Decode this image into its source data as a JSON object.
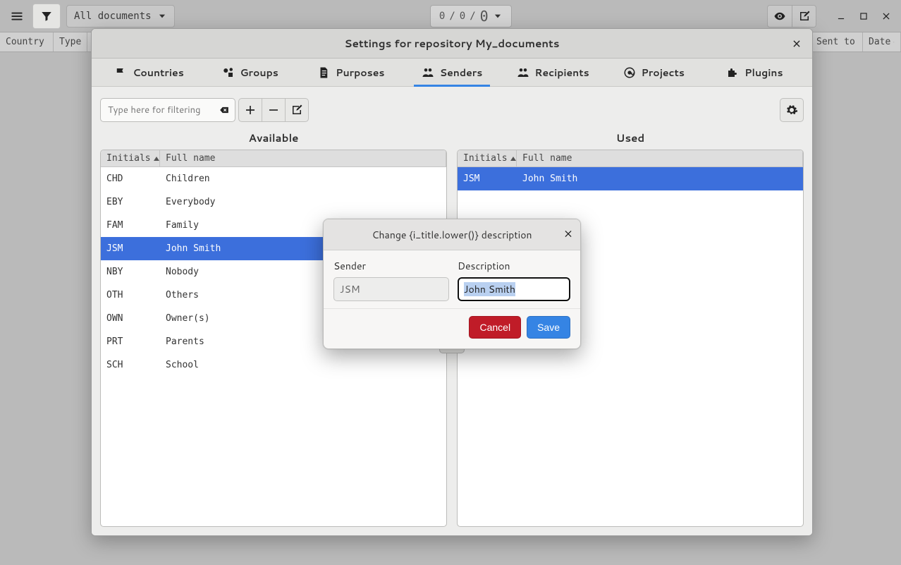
{
  "topbar": {
    "doc_selector": "All documents",
    "counter": {
      "a": "0",
      "b": "0",
      "c": "0"
    }
  },
  "columns": {
    "country": "Country",
    "type": "Type",
    "sent_to": "Sent to",
    "date": "Date"
  },
  "settings": {
    "title": "Settings for repository My_documents",
    "tabs": {
      "countries": "Countries",
      "groups": "Groups",
      "purposes": "Purposes",
      "senders": "Senders",
      "recipients": "Recipients",
      "projects": "Projects",
      "plugins": "Plugins"
    },
    "filter_placeholder": "Type here for filtering",
    "available_label": "Available",
    "used_label": "Used",
    "col_initials": "Initials",
    "col_full": "Full name",
    "available": [
      {
        "initials": "CHD",
        "full": "Children",
        "selected": false
      },
      {
        "initials": "EBY",
        "full": "Everybody",
        "selected": false
      },
      {
        "initials": "FAM",
        "full": "Family",
        "selected": false
      },
      {
        "initials": "JSM",
        "full": "John Smith",
        "selected": true
      },
      {
        "initials": "NBY",
        "full": "Nobody",
        "selected": false
      },
      {
        "initials": "OTH",
        "full": "Others",
        "selected": false
      },
      {
        "initials": "OWN",
        "full": "Owner(s)",
        "selected": false
      },
      {
        "initials": "PRT",
        "full": "Parents",
        "selected": false
      },
      {
        "initials": "SCH",
        "full": "School",
        "selected": false
      }
    ],
    "used": [
      {
        "initials": "JSM",
        "full": "John Smith",
        "selected": true
      }
    ]
  },
  "edit_popup": {
    "title": "Change {i_title.lower()} description",
    "sender_label": "Sender",
    "description_label": "Description",
    "sender_value": "JSM",
    "description_value": "John Smith",
    "cancel": "Cancel",
    "save": "Save"
  }
}
